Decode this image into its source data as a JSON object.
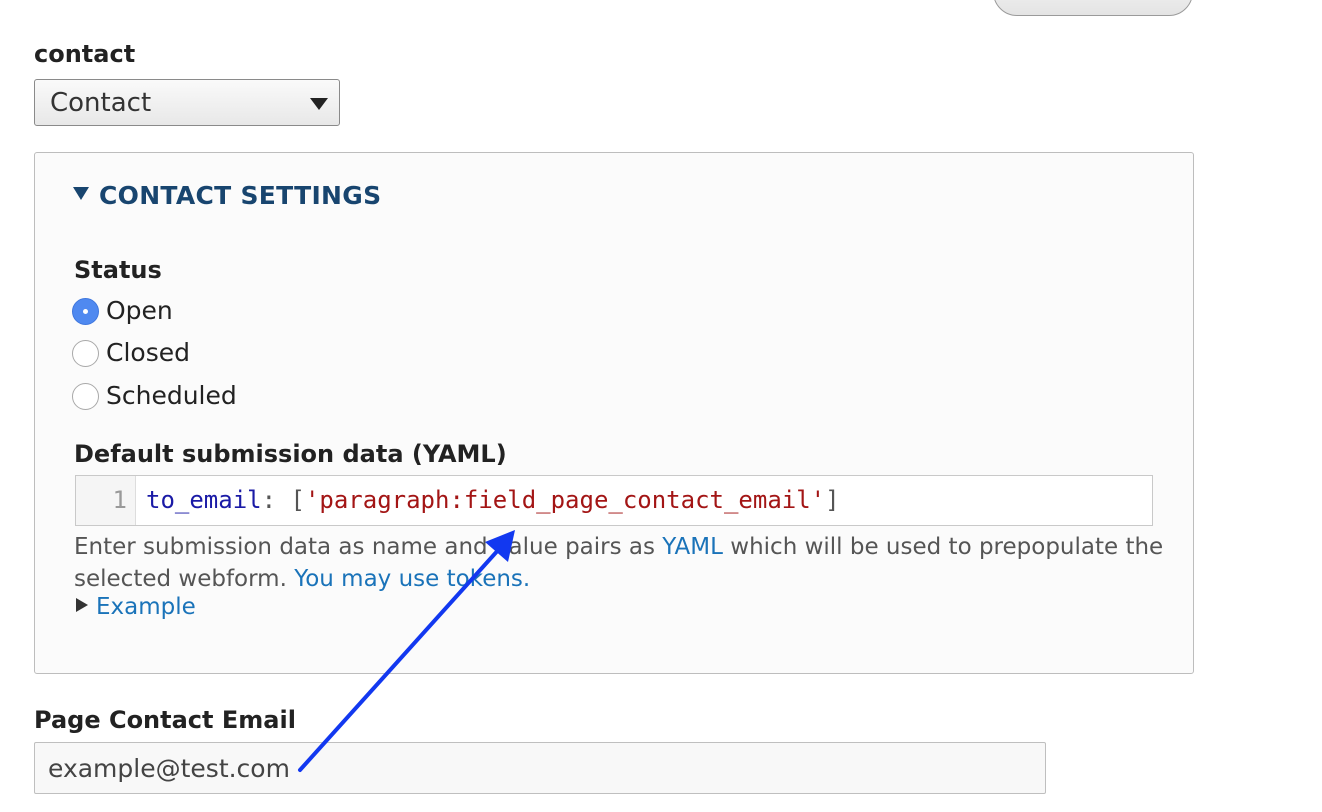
{
  "contact_field": {
    "label": "contact",
    "selected": "Contact"
  },
  "settings": {
    "summary": "CONTACT SETTINGS",
    "status": {
      "label": "Status",
      "options": [
        "Open",
        "Closed",
        "Scheduled"
      ],
      "selected": "Open"
    },
    "default_data": {
      "label": "Default submission data (YAML)",
      "line_number": "1",
      "code": {
        "key": "to_email",
        "colon": ":",
        "open": "[",
        "value": "'paragraph:field_page_contact_email'",
        "close": "]"
      },
      "description": {
        "part1": "Enter submission data as name and value pairs as ",
        "yaml_link": "YAML",
        "part2": " which will be used to prepopulate the selected webform. ",
        "tokens_link": "You may use tokens."
      },
      "example_label": "Example"
    }
  },
  "page_contact_email": {
    "label": "Page Contact Email",
    "value": "example@test.com"
  },
  "annotation": {
    "color": "#1238f0"
  }
}
